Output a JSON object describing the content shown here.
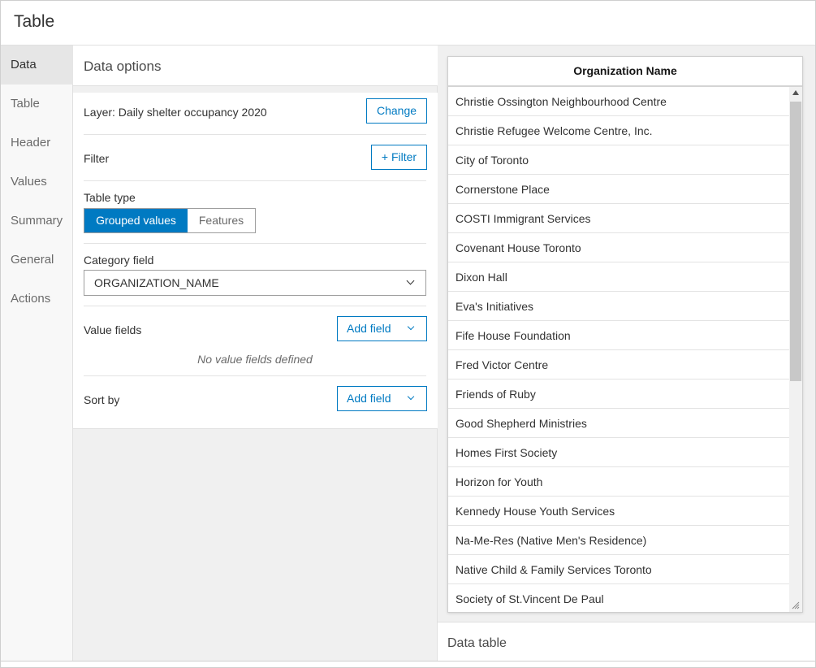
{
  "window": {
    "title": "Table"
  },
  "nav": {
    "items": [
      {
        "label": "Data",
        "active": true
      },
      {
        "label": "Table",
        "active": false
      },
      {
        "label": "Header",
        "active": false
      },
      {
        "label": "Values",
        "active": false
      },
      {
        "label": "Summary",
        "active": false
      },
      {
        "label": "General",
        "active": false
      },
      {
        "label": "Actions",
        "active": false
      }
    ]
  },
  "data_options": {
    "title": "Data options",
    "layer_label": "Layer: Daily shelter occupancy 2020",
    "change_button": "Change",
    "filter_label": "Filter",
    "filter_button": "+ Filter",
    "table_type_label": "Table type",
    "table_type_options": [
      "Grouped values",
      "Features"
    ],
    "table_type_selected": "Grouped values",
    "category_field_label": "Category field",
    "category_field_value": "ORGANIZATION_NAME",
    "value_fields_label": "Value fields",
    "value_fields_button": "Add field",
    "value_fields_empty": "No value fields defined",
    "sort_by_label": "Sort by",
    "sort_by_button": "Add field"
  },
  "preview": {
    "column_header": "Organization Name",
    "rows": [
      "Christie Ossington Neighbourhood Centre",
      "Christie Refugee Welcome Centre, Inc.",
      "City of Toronto",
      "Cornerstone Place",
      "COSTI Immigrant Services",
      "Covenant House Toronto",
      "Dixon Hall",
      "Eva's Initiatives",
      "Fife House Foundation",
      "Fred Victor Centre",
      "Friends of Ruby",
      "Good Shepherd Ministries",
      "Homes First Society",
      "Horizon for Youth",
      "Kennedy House Youth Services",
      "Na-Me-Res (Native Men's Residence)",
      "Native Child & Family Services Toronto",
      "Society of St.Vincent De Paul"
    ],
    "footer_label": "Data table"
  },
  "colors": {
    "accent": "#007ac2"
  }
}
